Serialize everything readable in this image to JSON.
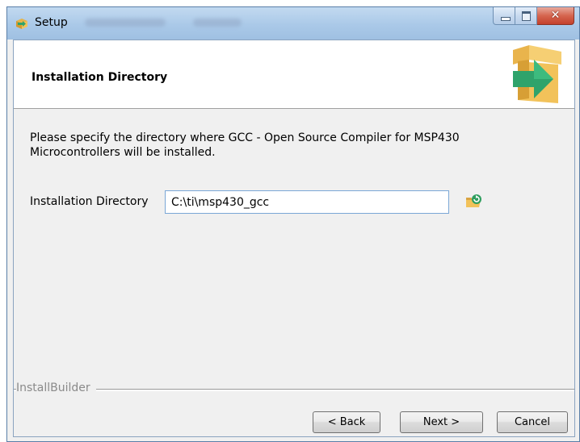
{
  "window": {
    "title": "Setup"
  },
  "header": {
    "title": "Installation Directory"
  },
  "body": {
    "description": "Please specify the directory where GCC - Open Source Compiler for MSP430 Microcontrollers  will be installed.",
    "directory_label": "Installation Directory",
    "directory_value": "C:\\ti\\msp430_gcc"
  },
  "footer": {
    "brand": "InstallBuilder",
    "back_label": "< Back",
    "next_label": "Next >",
    "cancel_label": "Cancel"
  },
  "icons": {
    "app": "setup-box-icon",
    "header": "box-arrow-icon",
    "browse": "folder-browse-icon"
  },
  "colors": {
    "box": "#f2c25a",
    "arrow": "#2fa36b",
    "close_button": "#c4402b",
    "titlebar": "#aac9e8"
  }
}
